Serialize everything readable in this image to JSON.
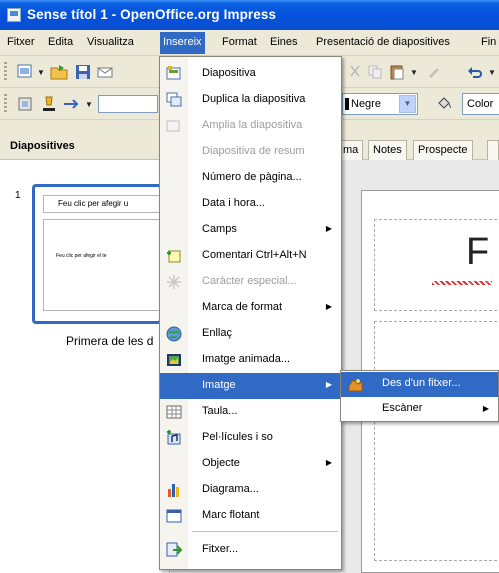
{
  "window": {
    "title": "Sense títol 1 - OpenOffice.org Impress"
  },
  "menubar": {
    "items": [
      "Fitxer",
      "Edita",
      "Visualitza",
      "Insereix",
      "Format",
      "Eines",
      "Presentació de diapositives",
      "Fin"
    ]
  },
  "toolbar": {
    "line_color": "Negre",
    "area_mode": "Color"
  },
  "slides_panel": {
    "title": "Diapositives",
    "slide_number": "1",
    "thumb_title": "Feu clic per afegir u",
    "thumb_body": "Feu clic per afegir el te",
    "caption": "Primera de les d"
  },
  "view_tabs": [
    "ma",
    "Notes",
    "Prospecte"
  ],
  "slide_canvas": {
    "title_letter": "F"
  },
  "insert_menu": {
    "items": [
      {
        "label": "Diapositiva",
        "icon": "new-slide-icon"
      },
      {
        "label": "Duplica la diapositiva",
        "icon": "duplicate-slide-icon"
      },
      {
        "label": "Amplia la diapositiva",
        "icon": "expand-slide-icon",
        "disabled": true
      },
      {
        "label": "Diapositiva de resum",
        "disabled": true
      },
      {
        "label": "Número de pàgina..."
      },
      {
        "label": "Data i hora..."
      },
      {
        "label": "Camps",
        "submenu": true
      },
      {
        "label": "Comentari  Ctrl+Alt+N",
        "icon": "comment-icon"
      },
      {
        "label": "Caràcter especial...",
        "icon": "special-character-icon",
        "disabled": true
      },
      {
        "label": "Marca de format",
        "submenu": true
      },
      {
        "label": "Enllaç",
        "icon": "hyperlink-icon"
      },
      {
        "label": "Imatge animada...",
        "icon": "animated-image-icon"
      },
      {
        "label": "Imatge",
        "submenu": true,
        "highlighted": true
      },
      {
        "label": "Taula...",
        "icon": "table-icon"
      },
      {
        "label": "Pel·lícules i so",
        "icon": "movie-sound-icon"
      },
      {
        "label": "Objecte",
        "submenu": true
      },
      {
        "label": "Diagrama...",
        "icon": "chart-icon"
      },
      {
        "label": "Marc flotant",
        "icon": "floating-frame-icon"
      },
      {
        "label": "Fitxer...",
        "icon": "insert-file-icon"
      }
    ]
  },
  "image_submenu": {
    "items": [
      {
        "label": "Des d'un fitxer...",
        "icon": "image-from-file-icon",
        "highlighted": true
      },
      {
        "label": "Escàner",
        "submenu": true
      }
    ]
  },
  "colors": {
    "titlebar": "#0550dc",
    "chrome": "#ece9d8",
    "highlight": "#316ac5",
    "slide_selection": "#316ac5"
  }
}
